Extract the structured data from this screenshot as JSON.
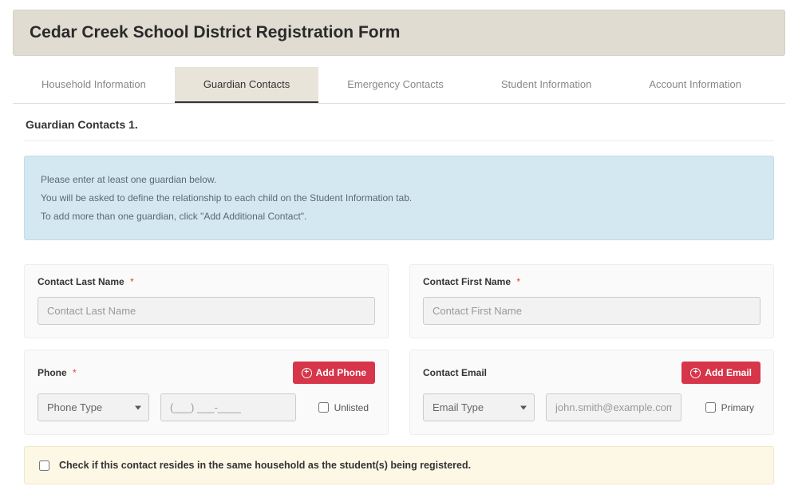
{
  "header": {
    "title": "Cedar Creek School District Registration Form"
  },
  "tabs": [
    {
      "label": "Household Information",
      "active": false
    },
    {
      "label": "Guardian Contacts",
      "active": true
    },
    {
      "label": "Emergency Contacts",
      "active": false
    },
    {
      "label": "Student Information",
      "active": false
    },
    {
      "label": "Account Information",
      "active": false
    }
  ],
  "section": {
    "title": "Guardian Contacts 1."
  },
  "info": {
    "line1": "Please enter at least one guardian below.",
    "line2": "You will be asked to define the relationship to each child on the Student Information tab.",
    "line3": "To add more than one guardian, click \"Add Additional Contact\"."
  },
  "fields": {
    "lastName": {
      "label": "Contact Last Name",
      "required": "*",
      "placeholder": "Contact Last Name"
    },
    "firstName": {
      "label": "Contact First Name",
      "required": "*",
      "placeholder": "Contact First Name"
    },
    "phone": {
      "label": "Phone",
      "required": "*",
      "addBtn": "Add Phone",
      "typeSelected": "Phone Type",
      "numberPlaceholder": "(___) ___-____",
      "unlistedLabel": "Unlisted"
    },
    "email": {
      "label": "Contact Email",
      "addBtn": "Add Email",
      "typeSelected": "Email Type",
      "placeholder": "john.smith@example.com",
      "primaryLabel": "Primary"
    }
  },
  "household": {
    "label": "Check if this contact resides in the same household as the student(s) being registered."
  }
}
